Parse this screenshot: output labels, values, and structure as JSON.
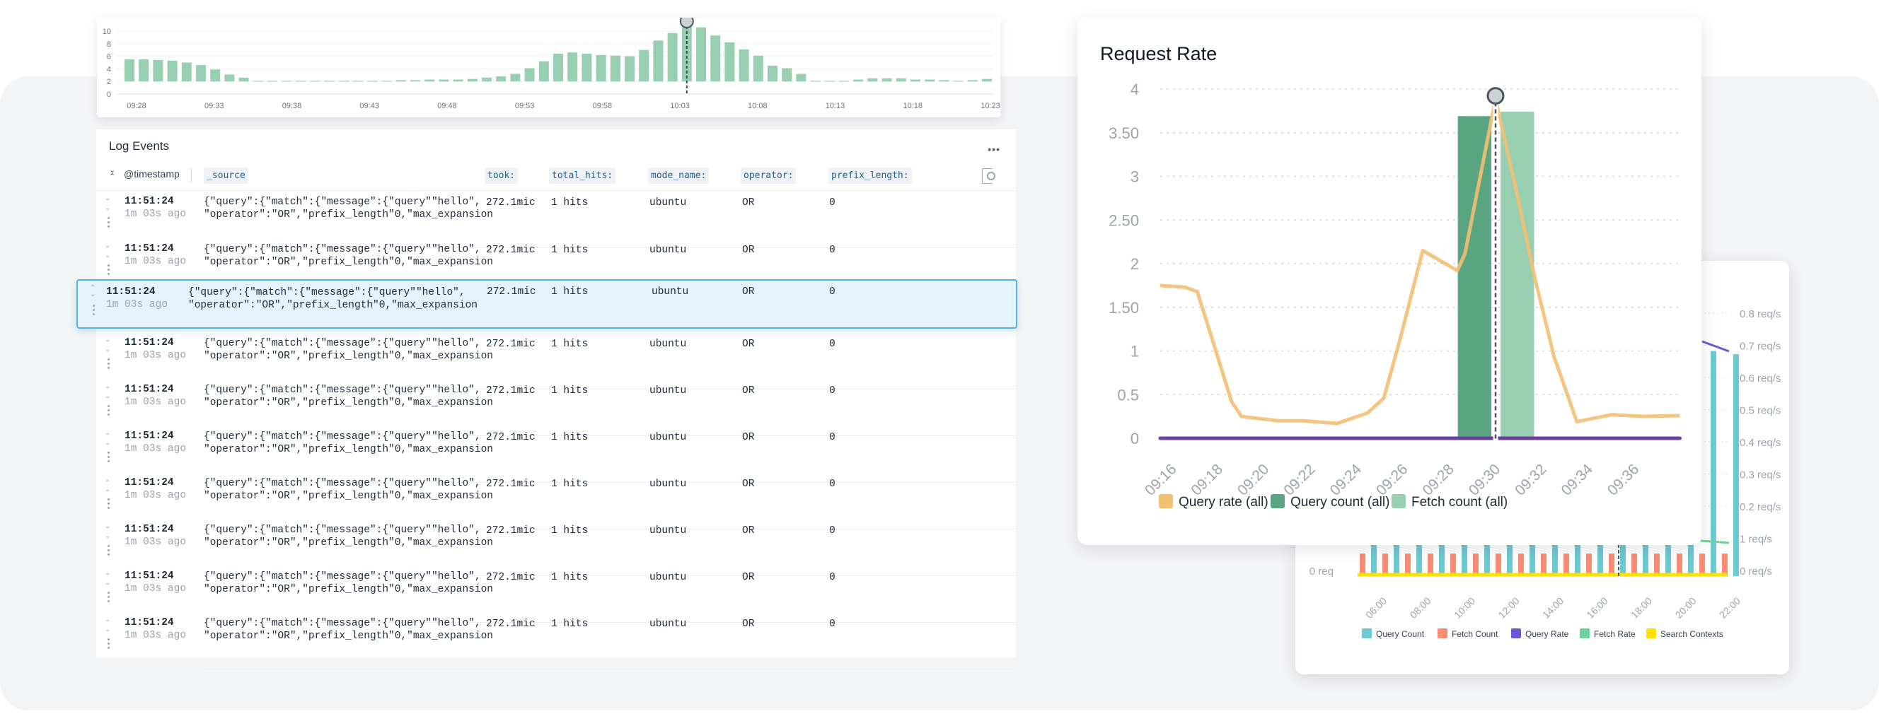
{
  "histogram": {
    "chart_data": {
      "type": "bar",
      "ylim": [
        0,
        10
      ],
      "yticks": [
        "0",
        "2",
        "4",
        "6",
        "8",
        "10"
      ],
      "xticks": [
        "09:28",
        "09:33",
        "09:38",
        "09:43",
        "09:48",
        "09:53",
        "09:58",
        "10:03",
        "10:08",
        "10:13",
        "10:18",
        "10:23"
      ],
      "values": [
        5.5,
        5.5,
        5.4,
        5.3,
        5.0,
        4.6,
        3.9,
        3.1,
        2.6,
        2.1,
        2.1,
        2.1,
        2.1,
        2.1,
        2.1,
        2.1,
        2.1,
        2.1,
        2.1,
        2.2,
        2.2,
        2.3,
        2.3,
        2.3,
        2.4,
        2.6,
        2.8,
        3.2,
        4.1,
        5.2,
        6.4,
        6.6,
        6.4,
        6.2,
        6.1,
        6.0,
        7.0,
        8.5,
        9.7,
        11.3,
        10.6,
        9.3,
        8.2,
        7.1,
        6.1,
        4.5,
        4.1,
        3.2,
        2.1,
        2.1,
        2.1,
        2.3,
        2.5,
        2.5,
        2.5,
        2.3,
        2.3,
        2.2,
        2.1,
        2.2,
        2.4
      ],
      "highlight_index": 39,
      "bar_color": "#98cfb1",
      "grid": true
    }
  },
  "log_events": {
    "title": "Log Events",
    "more_label": "•••",
    "timestamp_header": "@timestamp",
    "columns": [
      "_source",
      "took:",
      "total_hits:",
      "mode_name:",
      "operator:",
      "prefix_length:"
    ],
    "selected_row": 2,
    "rows": [
      {
        "time": "11:51:24",
        "ago": "1m 03s ago",
        "source": "{\"query\":{\"match\":{\"message\":{\"query\"\"hello\",\n\"operator\":\"OR\",\"prefix_length\"0,\"max_expansion",
        "took": "272.1mic",
        "hits": "1 hits",
        "mode": "ubuntu",
        "operator": "OR",
        "prefix": "0"
      },
      {
        "time": "11:51:24",
        "ago": "1m 03s ago",
        "source": "{\"query\":{\"match\":{\"message\":{\"query\"\"hello\",\n\"operator\":\"OR\",\"prefix_length\"0,\"max_expansion",
        "took": "272.1mic",
        "hits": "1 hits",
        "mode": "ubuntu",
        "operator": "OR",
        "prefix": "0"
      },
      {
        "time": "11:51:24",
        "ago": "1m 03s ago",
        "source": "{\"query\":{\"match\":{\"message\":{\"query\"\"hello\",\n\"operator\":\"OR\",\"prefix_length\"0,\"max_expansion",
        "took": "272.1mic",
        "hits": "1 hits",
        "mode": "ubuntu",
        "operator": "OR",
        "prefix": "0"
      },
      {
        "time": "11:51:24",
        "ago": "1m 03s ago",
        "source": "{\"query\":{\"match\":{\"message\":{\"query\"\"hello\",\n\"operator\":\"OR\",\"prefix_length\"0,\"max_expansion",
        "took": "272.1mic",
        "hits": "1 hits",
        "mode": "ubuntu",
        "operator": "OR",
        "prefix": "0"
      },
      {
        "time": "11:51:24",
        "ago": "1m 03s ago",
        "source": "{\"query\":{\"match\":{\"message\":{\"query\"\"hello\",\n\"operator\":\"OR\",\"prefix_length\"0,\"max_expansion",
        "took": "272.1mic",
        "hits": "1 hits",
        "mode": "ubuntu",
        "operator": "OR",
        "prefix": "0"
      },
      {
        "time": "11:51:24",
        "ago": "1m 03s ago",
        "source": "{\"query\":{\"match\":{\"message\":{\"query\"\"hello\",\n\"operator\":\"OR\",\"prefix_length\"0,\"max_expansion",
        "took": "272.1mic",
        "hits": "1 hits",
        "mode": "ubuntu",
        "operator": "OR",
        "prefix": "0"
      },
      {
        "time": "11:51:24",
        "ago": "1m 03s ago",
        "source": "{\"query\":{\"match\":{\"message\":{\"query\"\"hello\",\n\"operator\":\"OR\",\"prefix_length\"0,\"max_expansion",
        "took": "272.1mic",
        "hits": "1 hits",
        "mode": "ubuntu",
        "operator": "OR",
        "prefix": "0"
      },
      {
        "time": "11:51:24",
        "ago": "1m 03s ago",
        "source": "{\"query\":{\"match\":{\"message\":{\"query\"\"hello\",\n\"operator\":\"OR\",\"prefix_length\"0,\"max_expansion",
        "took": "272.1mic",
        "hits": "1 hits",
        "mode": "ubuntu",
        "operator": "OR",
        "prefix": "0"
      },
      {
        "time": "11:51:24",
        "ago": "1m 03s ago",
        "source": "{\"query\":{\"match\":{\"message\":{\"query\"\"hello\",\n\"operator\":\"OR\",\"prefix_length\"0,\"max_expansion",
        "took": "272.1mic",
        "hits": "1 hits",
        "mode": "ubuntu",
        "operator": "OR",
        "prefix": "0"
      },
      {
        "time": "11:51:24",
        "ago": "1m 03s ago",
        "source": "{\"query\":{\"match\":{\"message\":{\"query\"\"hello\",\n\"operator\":\"OR\",\"prefix_length\"0,\"max_expansion",
        "took": "272.1mic",
        "hits": "1 hits",
        "mode": "ubuntu",
        "operator": "OR",
        "prefix": "0"
      }
    ]
  },
  "request_rate": {
    "title": "Request Rate",
    "chart_data": {
      "type": "line",
      "title": "Request Rate",
      "ylim": [
        0,
        4
      ],
      "yticks": [
        "0",
        "0.5",
        "1",
        "1.50",
        "2",
        "2.50",
        "3",
        "3.50",
        "4"
      ],
      "xticks": [
        "09:16",
        "09:18",
        "09:20",
        "09:22",
        "09:24",
        "09:26",
        "09:28",
        "09:30",
        "09:32",
        "09:34",
        "09:36"
      ],
      "xlim": [
        "09:15:16",
        "09:37:45"
      ],
      "grid": true,
      "legend": "bottom",
      "hover_time": "09:29:46",
      "series": [
        {
          "name": "Query rate (all)",
          "type": "line",
          "color": "#f3bf72",
          "points": [
            [
              "09:15:16",
              1.75
            ],
            [
              "09:16:20",
              1.73
            ],
            [
              "09:16:52",
              1.68
            ],
            [
              "09:17:34",
              1.09
            ],
            [
              "09:18:21",
              0.42
            ],
            [
              "09:18:47",
              0.25
            ],
            [
              "09:20:22",
              0.2
            ],
            [
              "09:21:25",
              0.2
            ],
            [
              "09:22:55",
              0.17
            ],
            [
              "09:24:14",
              0.29
            ],
            [
              "09:24:56",
              0.46
            ],
            [
              "09:25:38",
              1.13
            ],
            [
              "09:26:37",
              2.15
            ],
            [
              "09:28:07",
              1.92
            ],
            [
              "09:28:27",
              2.12
            ],
            [
              "09:29:46",
              3.89
            ],
            [
              "09:30:44",
              2.75
            ],
            [
              "09:31:26",
              1.87
            ],
            [
              "09:32:18",
              0.93
            ],
            [
              "09:33:17",
              0.19
            ],
            [
              "09:34:47",
              0.27
            ],
            [
              "09:36:11",
              0.25
            ],
            [
              "09:37:44",
              0.26
            ]
          ]
        },
        {
          "name": "Query count (all)",
          "type": "bar",
          "color": "#5aa581",
          "bars": [
            {
              "start": "09:28:08",
              "end": "09:29:35",
              "value": 3.69
            }
          ]
        },
        {
          "name": "Fetch count (all)",
          "type": "bar",
          "color": "#98cfb1",
          "bars": [
            {
              "start": "09:29:59",
              "end": "09:31:26",
              "value": 3.74
            }
          ]
        },
        {
          "type": "line",
          "color": "#6b3fa0",
          "points": [
            [
              "09:15:16",
              0
            ],
            [
              "09:37:44",
              0
            ]
          ]
        }
      ]
    }
  },
  "background_chart": {
    "chart_data": {
      "type": "bar",
      "left_tick": "0 req",
      "right_yticks": [
        "0.8 req/s",
        "0.7 req/s",
        "0.6 req/s",
        "0.5 req/s",
        "0.4 req/s",
        "0.3 req/s",
        "0.2 req/s",
        "1 req/s",
        "0 req/s"
      ],
      "xticks": [
        "06:00",
        "08:00",
        "10:00",
        "12:00",
        "14:00",
        "16:00",
        "18:00",
        "20:00",
        "22:00"
      ],
      "legend": "bottom",
      "series": [
        {
          "name": "Query Count",
          "color": "#6ccbd0",
          "values": [
            1.2,
            1.2,
            1.2,
            1.2,
            1.2,
            1.2,
            1.2,
            1.2,
            1.2,
            1.2,
            1.2,
            1.2,
            1.2,
            1.2,
            1.2,
            0.7,
            0.69
          ]
        },
        {
          "name": "Fetch Count",
          "color": "#fb8c72",
          "values": [
            0.07,
            0.07,
            0.07,
            0.07,
            0.07,
            0.07,
            0.07,
            0.07,
            0.07,
            0.07,
            0.07,
            0.07,
            0.07,
            0.07,
            0.07,
            0.07,
            0.07
          ]
        },
        {
          "name": "Query Rate",
          "color": "#7056d6"
        },
        {
          "name": "Fetch Rate",
          "color": "#6dd39a"
        },
        {
          "name": "Search Contexts",
          "color": "#ffe000"
        }
      ]
    }
  }
}
